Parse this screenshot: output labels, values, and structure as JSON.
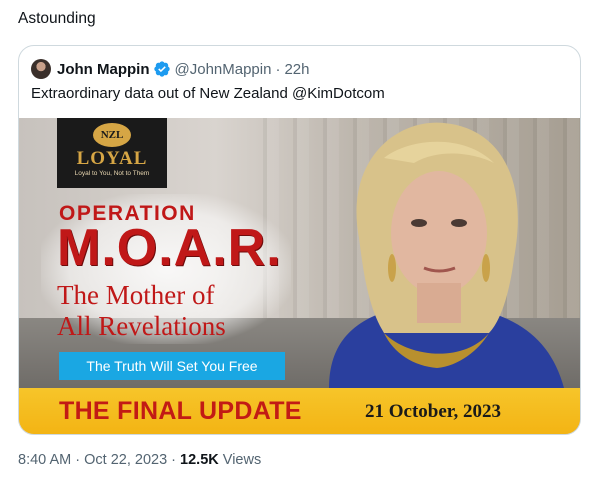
{
  "tweet": {
    "text": "Astounding",
    "meta": {
      "time": "8:40 AM",
      "date": "Oct 22, 2023",
      "views_count": "12.5K",
      "views_label": "Views",
      "separator": "·"
    }
  },
  "quote": {
    "author_name": "John Mappin",
    "handle": "@JohnMappin",
    "separator": "·",
    "time_ago": "22h",
    "text": "Extraordinary data out of New Zealand @KimDotcom",
    "verified_color": "#1d9bf0"
  },
  "media": {
    "logo": {
      "badge": "NZL",
      "word": "LOYAL",
      "tagline": "Loyal to You, Not to Them"
    },
    "operation": "OPERATION",
    "moar": "M.O.A.R.",
    "subtitle_line1": "The Mother of",
    "subtitle_line2": "All Revelations",
    "banner": "The Truth Will Set You Free",
    "final_update": "THE FINAL UPDATE",
    "date": "21 October, 2023",
    "colors": {
      "title_red": "#c01818",
      "banner_blue": "#1aa7e3",
      "bar_yellow": "#f3b414"
    }
  }
}
